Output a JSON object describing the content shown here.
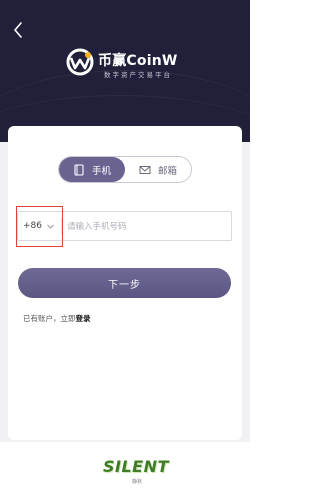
{
  "header": {
    "brand_name": "币赢CoinW",
    "brand_tagline": "数字资产交易平台"
  },
  "tabs": [
    {
      "label": "手机",
      "icon": "phone-book-icon",
      "active": true
    },
    {
      "label": "邮箱",
      "icon": "envelope-icon",
      "active": false
    }
  ],
  "phone": {
    "country_code": "+86",
    "placeholder": "请输入手机号码",
    "value": ""
  },
  "next_button_label": "下一步",
  "login_hint": {
    "prefix": "已有账户，立即",
    "link": "登录"
  },
  "watermark": {
    "text": "SILENT",
    "sub": "静默"
  },
  "colors": {
    "header_bg": "#20203a",
    "accent": "#6a6390",
    "highlight": "#e2403a"
  }
}
